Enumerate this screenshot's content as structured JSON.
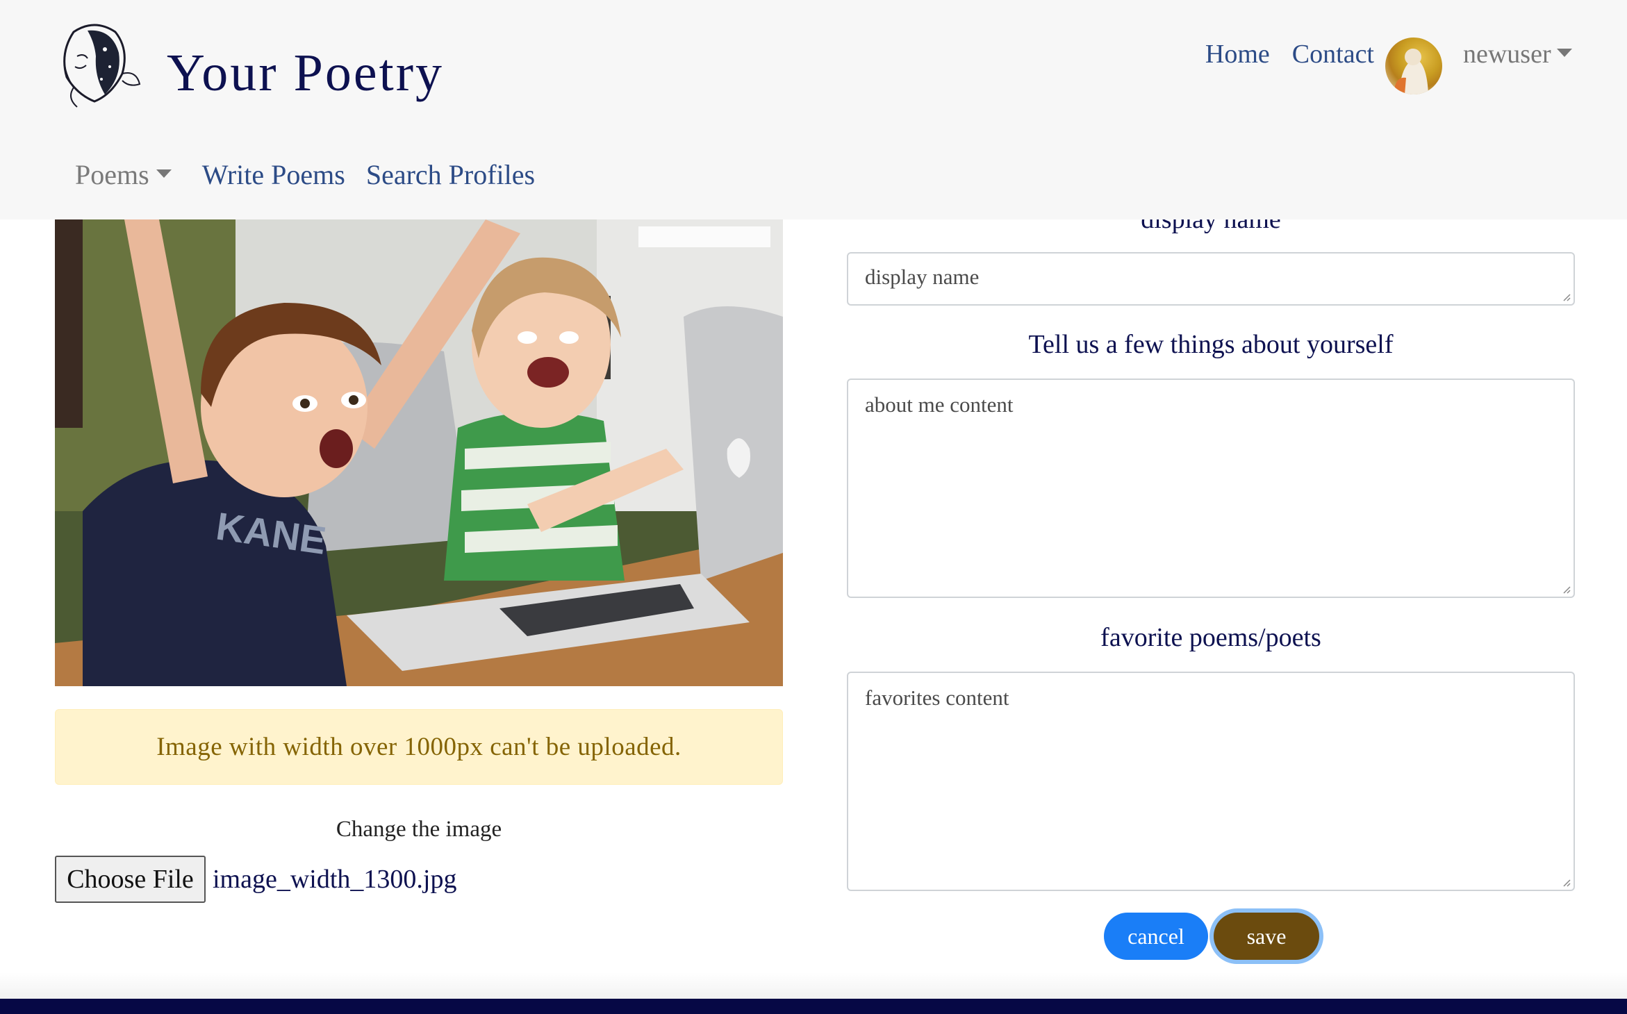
{
  "brand": {
    "title": "Your Poetry"
  },
  "nav": {
    "home": "Home",
    "contact": "Contact",
    "username": "newuser",
    "poems_menu": "Poems",
    "write_poems": "Write Poems",
    "search_profiles": "Search Profiles"
  },
  "profile_image": {
    "alert": "Image with width over 1000px can't be uploaded.",
    "change_label": "Change the image",
    "choose_button": "Choose File",
    "file_name": "image_width_1300.jpg"
  },
  "form": {
    "display_name_heading": "display name",
    "display_name_value": "display name",
    "about_heading": "Tell us a few things about yourself",
    "about_value": "about me content",
    "favorites_heading": "favorite poems/poets",
    "favorites_value": "favorites content",
    "cancel_label": "cancel",
    "save_label": "save"
  },
  "colors": {
    "navbar_bg": "#f7f7f7",
    "brand": "#0d1150",
    "link": "#2c4b86",
    "cancel": "#1a7ef7",
    "save": "#6b4b0e",
    "alert_bg": "#fff3cd",
    "alert_text": "#856404",
    "footer": "#060845"
  }
}
